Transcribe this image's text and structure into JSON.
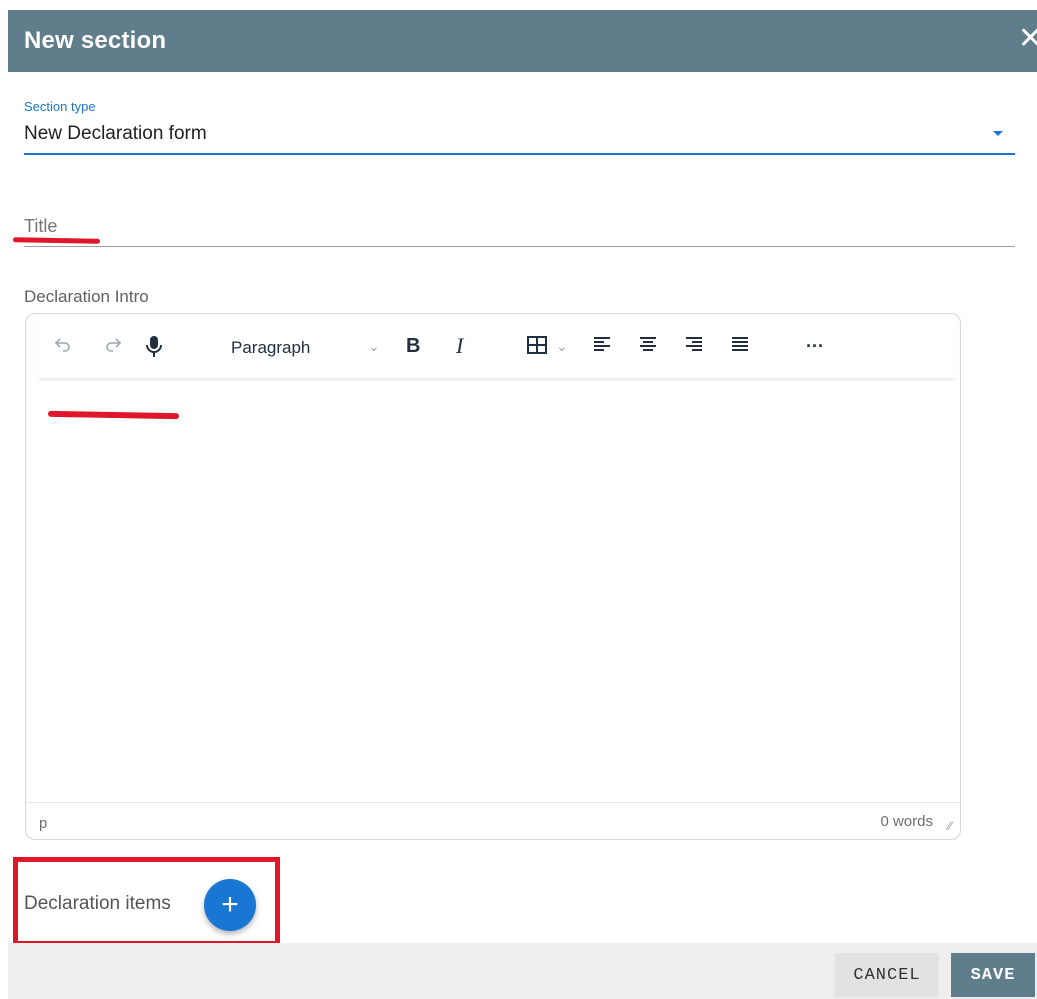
{
  "dialog": {
    "title": "New section",
    "close_icon": "close-icon",
    "close_glyph": "✕"
  },
  "section_type": {
    "label": "Section type",
    "value": "New Declaration form",
    "icon": "dropdown-arrow-icon"
  },
  "title_field": {
    "placeholder": "Title"
  },
  "intro": {
    "label": "Declaration Intro",
    "toolbar": {
      "undo_icon": "undo-icon",
      "redo_icon": "redo-icon",
      "mic_icon": "microphone-icon",
      "block_format": "Paragraph",
      "bold_label": "B",
      "italic_label": "I",
      "table_icon": "table-icon",
      "align_left_icon": "align-left-icon",
      "align_center_icon": "align-center-icon",
      "align_right_icon": "align-right-icon",
      "justify_icon": "align-justify-icon",
      "more_label": "···"
    },
    "status_path": "p",
    "word_count": "0 words"
  },
  "declaration_items": {
    "label": "Declaration items",
    "add_label": "+"
  },
  "footer": {
    "cancel_label": "CANCEL",
    "save_label": "SAVE"
  },
  "colors": {
    "header": "#607d8b",
    "accent": "#1976d2",
    "annotation_red": "#e0162b"
  }
}
